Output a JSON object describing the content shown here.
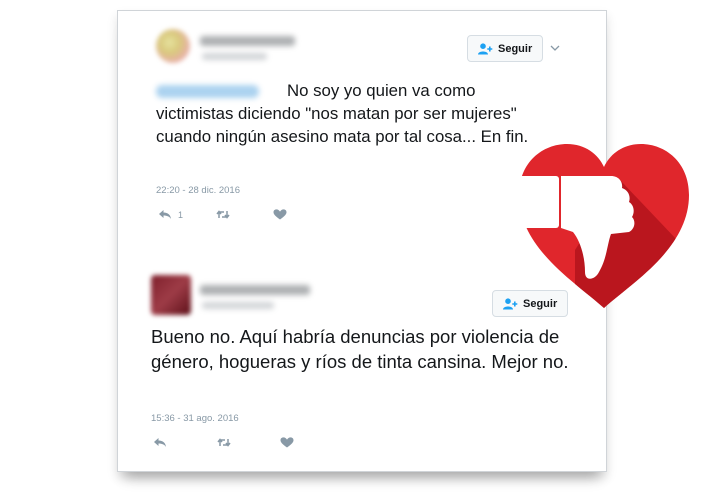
{
  "tweets": [
    {
      "follow_label": "Seguir",
      "text": "No soy yo quien va como victimistas diciendo \"nos matan por ser mujeres\" cuando ningún asesino mata por tal cosa... En fin.",
      "timestamp": "22:20 - 28 dic. 2016",
      "reply_count": "1",
      "icons": [
        "reply-icon",
        "retweet-icon",
        "like-icon"
      ]
    },
    {
      "follow_label": "Seguir",
      "text": "Bueno no. Aquí habría denuncias por violencia de género, hogueras y ríos de tinta cansina. Mejor no.",
      "timestamp": "15:36 - 31 ago. 2016",
      "icons": [
        "reply-icon",
        "retweet-icon",
        "like-icon"
      ]
    }
  ],
  "colors": {
    "follow_icon": "#1da1f2",
    "muted": "#8899a6",
    "heart_red": "#e0262c",
    "heart_shadow": "#b3141c"
  },
  "overlay_icon": "thumbs-down-heart-icon"
}
